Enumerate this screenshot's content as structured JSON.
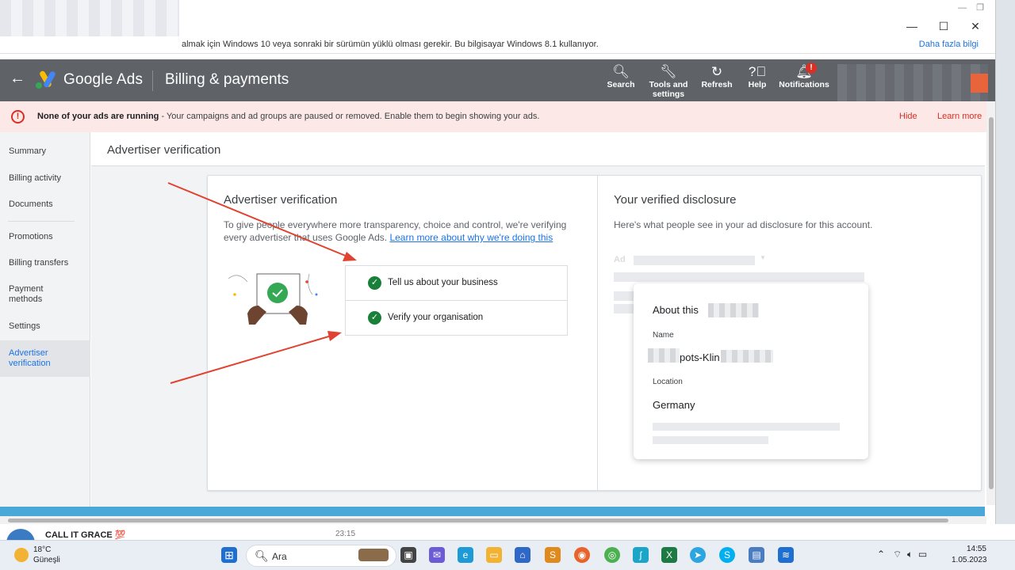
{
  "infobar": {
    "message": "almak için Windows 10 veya sonraki bir sürümün yüklü olması gerekir. Bu bilgisayar Windows 8.1 kullanıyor.",
    "more_link": "Daha fazla bilgi"
  },
  "window_controls": {
    "minimize": "—",
    "maximize": "☐",
    "close": "✕"
  },
  "header": {
    "brand": "Google Ads",
    "page": "Billing & payments",
    "tools": [
      {
        "label": "Search",
        "icon": "search-icon"
      },
      {
        "label": "Tools and settings",
        "icon": "wrench-icon"
      },
      {
        "label": "Refresh",
        "icon": "refresh-icon"
      },
      {
        "label": "Help",
        "icon": "help-icon"
      },
      {
        "label": "Notifications",
        "icon": "bell-icon",
        "badge": "!"
      }
    ]
  },
  "alert": {
    "bold": "None of your ads are running",
    "text": " - Your campaigns and ad groups are paused or removed. Enable them to begin showing your ads.",
    "hide": "Hide",
    "learn_more": "Learn more"
  },
  "sidebar": {
    "items": [
      {
        "label": "Summary"
      },
      {
        "label": "Billing activity"
      },
      {
        "label": "Documents"
      },
      {
        "label": "Promotions"
      },
      {
        "label": "Billing transfers"
      },
      {
        "label": "Payment methods"
      },
      {
        "label": "Settings"
      },
      {
        "label": "Advertiser verification",
        "active": true
      }
    ]
  },
  "main": {
    "page_title": "Advertiser verification",
    "left": {
      "title": "Advertiser verification",
      "description": "To give people everywhere more transparency, choice and control, we're verifying every advertiser that uses Google Ads. ",
      "link": "Learn more about why we're doing this",
      "steps": [
        {
          "label": "Tell us about your business",
          "done": true
        },
        {
          "label": "Verify your organisation",
          "done": true
        }
      ]
    },
    "right": {
      "title": "Your verified disclosure",
      "description": "Here's what people see in your ad disclosure for this account.",
      "ad_label": "Ad",
      "about": {
        "heading": "About this",
        "name_label": "Name",
        "name_value": "pots-Klin",
        "location_label": "Location",
        "location_value": "Germany"
      }
    }
  },
  "chat": {
    "name": "CALL IT GRACE 💯",
    "time": "23:15"
  },
  "taskbar": {
    "weather_temp": "18°C",
    "weather_text": "Güneşli",
    "search_label": "Ara",
    "time": "14:55",
    "date": "1.05.2023"
  },
  "colors": {
    "header_bg": "#5f6368",
    "alert_bg": "#fce8e6",
    "alert_accent": "#d93025",
    "link": "#1a73e8",
    "success": "#188038",
    "arrow": "#e0432f"
  }
}
